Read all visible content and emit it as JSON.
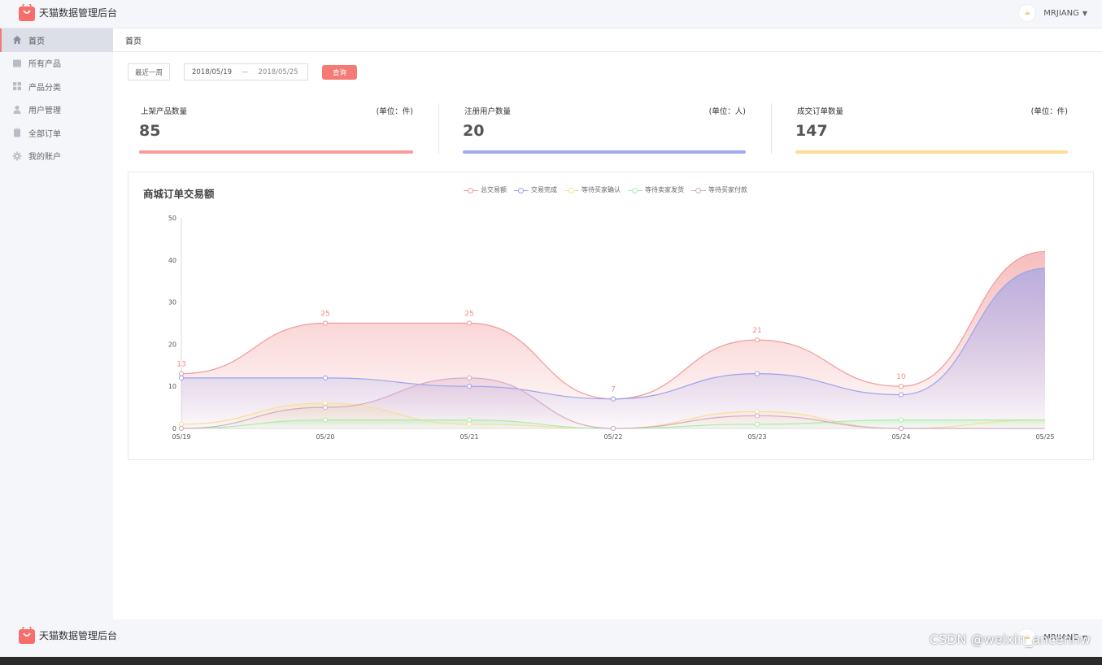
{
  "app": {
    "title": "天猫数据管理后台"
  },
  "user": {
    "avatar_text": "☕",
    "name": "MRJIANG"
  },
  "sidebar": {
    "items": [
      {
        "label": "首页",
        "icon": "home-icon",
        "active": true
      },
      {
        "label": "所有产品",
        "icon": "products-icon",
        "active": false
      },
      {
        "label": "产品分类",
        "icon": "category-icon",
        "active": false
      },
      {
        "label": "用户管理",
        "icon": "user-icon",
        "active": false
      },
      {
        "label": "全部订单",
        "icon": "orders-icon",
        "active": false
      },
      {
        "label": "我的账户",
        "icon": "gear-icon",
        "active": false
      }
    ]
  },
  "breadcrumb": {
    "current": "首页"
  },
  "filters": {
    "range_label": "最近一周",
    "start_date": "2018/05/19",
    "separator": "—",
    "end_date": "2018/05/25",
    "query_label": "查询"
  },
  "stats": [
    {
      "label": "上架产品数量",
      "unit": "(单位：件)",
      "value": "85",
      "color": "#f79c9a"
    },
    {
      "label": "注册用户数量",
      "unit": "(单位：人)",
      "value": "20",
      "color": "#a3a9ee"
    },
    {
      "label": "成交订单数量",
      "unit": "(单位：件)",
      "value": "147",
      "color": "#fedc95"
    }
  ],
  "chart_data": {
    "type": "area",
    "title": "商城订单交易额",
    "categories": [
      "05/19",
      "05/20",
      "05/21",
      "05/22",
      "05/23",
      "05/24",
      "05/25"
    ],
    "ylim": [
      0,
      50
    ],
    "yticks": [
      0,
      10,
      20,
      30,
      40,
      50
    ],
    "legend_position": "top-center",
    "series": [
      {
        "name": "总交易额",
        "color": "#f29a9a",
        "values": [
          13,
          25,
          25,
          7,
          21,
          10,
          42
        ],
        "labels": [
          "13",
          "25",
          "25",
          "7",
          "21",
          "10",
          ""
        ]
      },
      {
        "name": "交易完成",
        "color": "#9aa3ee",
        "values": [
          12,
          12,
          10,
          7,
          13,
          8,
          38
        ]
      },
      {
        "name": "等待买家确认",
        "color": "#f7df9a",
        "values": [
          1,
          6,
          1,
          0,
          4,
          0,
          2
        ]
      },
      {
        "name": "等待卖家发货",
        "color": "#a8eea8",
        "values": [
          0,
          2,
          2,
          0,
          1,
          2,
          2
        ]
      },
      {
        "name": "等待买家付款",
        "color": "#d7a9c8",
        "values": [
          0,
          5,
          12,
          0,
          3,
          0,
          0
        ]
      }
    ]
  },
  "footer": {
    "title": "天猫数据管理后台",
    "user_name": "MRJIANG"
  },
  "watermark": "CSDN @weixin_ancenhw"
}
